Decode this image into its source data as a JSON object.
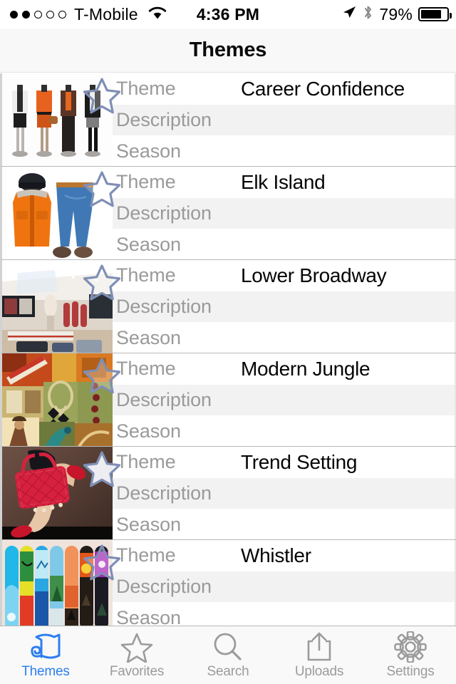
{
  "status_bar": {
    "signal_dots_total": 5,
    "signal_dots_filled": 2,
    "carrier": "T-Mobile",
    "wifi_icon": "wifi-icon",
    "time": "4:36 PM",
    "location_icon": "location-arrow-icon",
    "bluetooth_icon": "bluetooth-icon",
    "battery_percent": "79%",
    "battery_level": 79
  },
  "nav": {
    "title": "Themes"
  },
  "list": {
    "field_labels": {
      "theme": "Theme",
      "description": "Description",
      "season": "Season"
    },
    "rows": [
      {
        "theme": "Career Confidence",
        "description": "",
        "season": "",
        "thumb": "career-confidence-mannequins-thumbnail",
        "star": "favorite-star-icon",
        "star_filled": false
      },
      {
        "theme": "Elk Island",
        "description": "",
        "season": "",
        "thumb": "elk-island-winter-outfit-thumbnail",
        "star": "favorite-star-icon",
        "star_filled": false
      },
      {
        "theme": "Lower Broadway",
        "description": "",
        "season": "",
        "thumb": "lower-broadway-store-interior-thumbnail",
        "star": "favorite-star-icon",
        "star_filled": false
      },
      {
        "theme": "Modern Jungle",
        "description": "",
        "season": "",
        "thumb": "modern-jungle-collage-thumbnail",
        "star": "favorite-star-icon",
        "star_filled": false
      },
      {
        "theme": "Trend Setting",
        "description": "",
        "season": "",
        "thumb": "trend-setting-red-handbag-thumbnail",
        "star": "favorite-star-icon",
        "star_filled": true
      },
      {
        "theme": "Whistler",
        "description": "",
        "season": "",
        "thumb": "whistler-snowboards-thumbnail",
        "star": "favorite-star-icon",
        "star_filled": false
      }
    ]
  },
  "tabbar": {
    "active_index": 0,
    "tabs": [
      {
        "label": "Themes",
        "icon": "fabric-roll-icon"
      },
      {
        "label": "Favorites",
        "icon": "star-outline-icon"
      },
      {
        "label": "Search",
        "icon": "magnifier-icon"
      },
      {
        "label": "Uploads",
        "icon": "upload-share-icon"
      },
      {
        "label": "Settings",
        "icon": "gear-icon"
      }
    ]
  },
  "colors": {
    "accent_blue": "#2c7ef0",
    "label_gray": "#9a9a9a",
    "alt_row_bg": "#f2f2f2",
    "navbar_bg": "#f8f8f8",
    "tabbar_bg": "#f9f9f9",
    "star_stroke": "#7f8fb5"
  }
}
